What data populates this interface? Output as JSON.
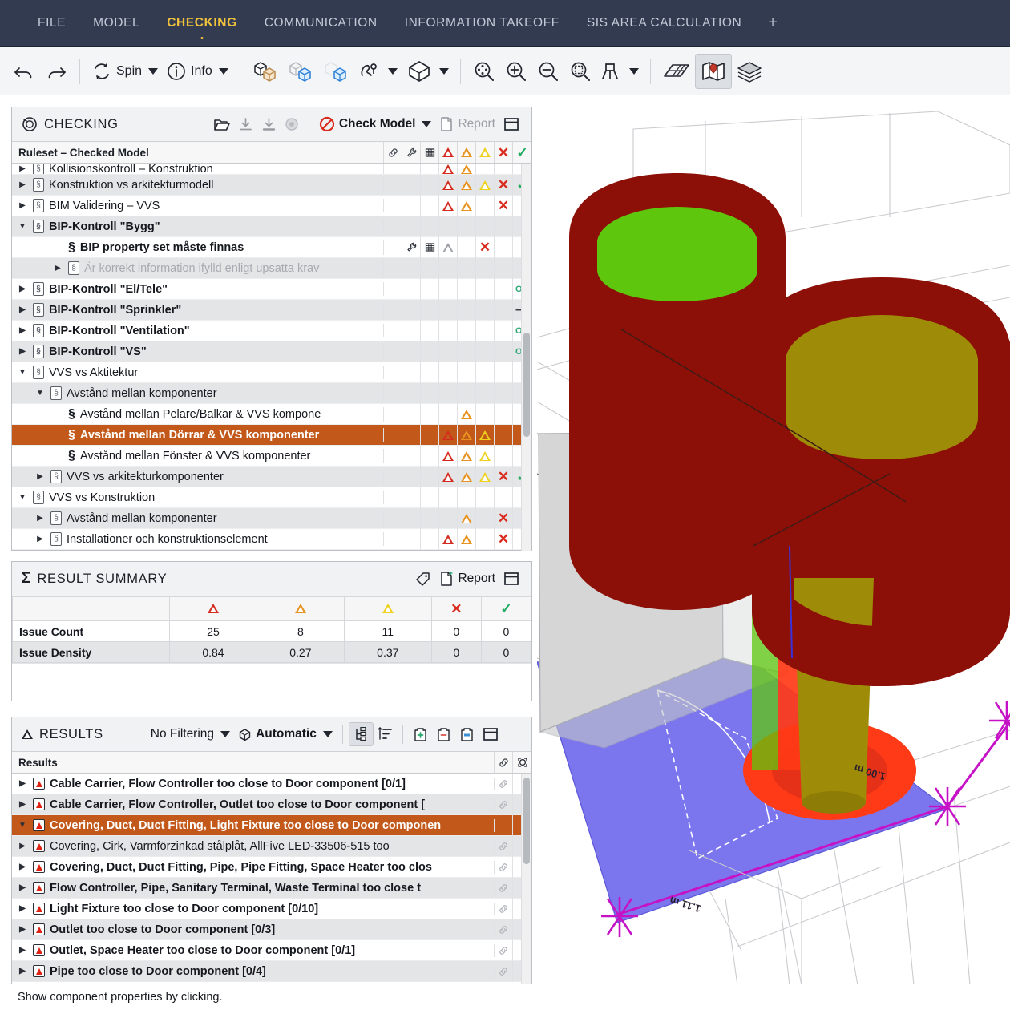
{
  "menubar": {
    "items": [
      {
        "label": "FILE",
        "active": false
      },
      {
        "label": "MODEL",
        "active": false
      },
      {
        "label": "CHECKING",
        "active": true
      },
      {
        "label": "COMMUNICATION",
        "active": false
      },
      {
        "label": "INFORMATION TAKEOFF",
        "active": false
      },
      {
        "label": "SIS AREA CALCULATION",
        "active": false
      }
    ],
    "add_label": "+"
  },
  "toolbar": {
    "undo": "undo-icon",
    "redo": "redo-icon",
    "spin_label": "Spin",
    "info_label": "Info",
    "icons": [
      "select-objects-icon",
      "select-transparent-icon",
      "select-hidden-icon",
      "paint-select-icon",
      "cube-view-icon",
      "zoom-fit-icon",
      "zoom-in-icon",
      "zoom-out-icon",
      "zoom-area-icon",
      "clip-plane-icon",
      "grid-icon",
      "map-pin-icon",
      "layers-icon"
    ]
  },
  "checking_panel": {
    "title": "CHECKING",
    "title_icon": "check-badge-icon",
    "open_icon": "open-folder-icon",
    "import_icon": "import-icon",
    "export_icon": "export-icon",
    "record_icon": "record-icon",
    "check_model_label": "Check Model",
    "check_model_icon": "forbidden-icon",
    "report_label": "Report",
    "report_icon": "report-doc-icon",
    "collapse_icon": "collapse-panel-icon",
    "grid_header": {
      "name": "Ruleset – Checked Model",
      "columns": [
        "link-icon",
        "wrench-icon",
        "table-icon",
        "red-triangle",
        "orange-triangle",
        "yellow-triangle",
        "x-mark",
        "check-mark"
      ]
    },
    "rows": [
      {
        "label": "Kollisionskontroll – Konstruktion",
        "indent": 1,
        "twist": "closed",
        "icon": "ruleset",
        "alt": false,
        "clipped": true,
        "marks": [
          "",
          "",
          "",
          "red",
          "orange",
          "",
          "",
          ""
        ]
      },
      {
        "label": "Konstruktion vs arkitekturmodell",
        "indent": 1,
        "twist": "closed",
        "icon": "ruleset",
        "alt": true,
        "marks": [
          "",
          "",
          "",
          "red",
          "orange",
          "yellow",
          "x",
          "check"
        ]
      },
      {
        "label": "BIM Validering – VVS",
        "indent": 1,
        "twist": "closed",
        "icon": "ruleset",
        "alt": false,
        "marks": [
          "",
          "",
          "",
          "red",
          "orange",
          "",
          "x",
          ""
        ]
      },
      {
        "label": "BIP-Kontroll \"Bygg\"",
        "indent": 1,
        "twist": "open",
        "icon": "ruleset",
        "alt": true,
        "bold": true,
        "marks": [
          "",
          "",
          "",
          "",
          "",
          "",
          "",
          ""
        ]
      },
      {
        "label": "BIP property set måste finnas",
        "indent": 3,
        "twist": "none",
        "icon": "para",
        "alt": false,
        "bold": true,
        "marks": [
          "",
          "wrench",
          "table",
          "hollow",
          "",
          "x",
          "",
          ""
        ]
      },
      {
        "label": "Är korrekt information ifylld enligt upsatta krav",
        "indent": 3,
        "twist": "closed",
        "icon": "ruleset",
        "alt": true,
        "disabled": true,
        "marks": [
          "",
          "",
          "",
          "",
          "",
          "",
          "",
          ""
        ]
      },
      {
        "label": "BIP-Kontroll \"El/Tele\"",
        "indent": 1,
        "twist": "closed",
        "icon": "ruleset",
        "alt": false,
        "bold": true,
        "marks": [
          "",
          "",
          "",
          "",
          "",
          "",
          "",
          "ok"
        ]
      },
      {
        "label": "BIP-Kontroll \"Sprinkler\"",
        "indent": 1,
        "twist": "closed",
        "icon": "ruleset",
        "alt": true,
        "bold": true,
        "marks": [
          "",
          "",
          "",
          "",
          "",
          "",
          "",
          "dash"
        ]
      },
      {
        "label": "BIP-Kontroll \"Ventilation\"",
        "indent": 1,
        "twist": "closed",
        "icon": "ruleset",
        "alt": false,
        "bold": true,
        "marks": [
          "",
          "",
          "",
          "",
          "",
          "",
          "",
          "ok"
        ]
      },
      {
        "label": "BIP-Kontroll \"VS\"",
        "indent": 1,
        "twist": "closed",
        "icon": "ruleset",
        "alt": true,
        "bold": true,
        "marks": [
          "",
          "",
          "",
          "",
          "",
          "",
          "",
          "ok"
        ]
      },
      {
        "label": "VVS vs Aktitektur",
        "indent": 1,
        "twist": "open",
        "icon": "ruleset",
        "alt": false,
        "marks": [
          "",
          "",
          "",
          "",
          "",
          "",
          "",
          ""
        ]
      },
      {
        "label": "Avstånd mellan komponenter",
        "indent": 2,
        "twist": "open",
        "icon": "ruleset",
        "alt": true,
        "marks": [
          "",
          "",
          "",
          "",
          "",
          "",
          "",
          ""
        ]
      },
      {
        "label": "Avstånd mellan Pelare/Balkar & VVS kompone",
        "indent": 3,
        "twist": "none",
        "icon": "para",
        "alt": false,
        "marks": [
          "",
          "",
          "",
          "",
          "orange",
          "",
          "",
          ""
        ]
      },
      {
        "label": "Avstånd mellan Dörrar & VVS komponenter",
        "indent": 3,
        "twist": "none",
        "icon": "para",
        "alt": false,
        "selected": true,
        "marks": [
          "",
          "",
          "",
          "red",
          "orange",
          "yellow",
          "",
          ""
        ]
      },
      {
        "label": "Avstånd mellan Fönster & VVS komponenter",
        "indent": 3,
        "twist": "none",
        "icon": "para",
        "alt": false,
        "marks": [
          "",
          "",
          "",
          "red",
          "orange",
          "yellow",
          "",
          ""
        ]
      },
      {
        "label": "VVS vs arkitekturkomponenter",
        "indent": 2,
        "twist": "closed",
        "icon": "ruleset",
        "alt": true,
        "marks": [
          "",
          "",
          "",
          "red",
          "orange",
          "yellow",
          "x",
          "check"
        ]
      },
      {
        "label": "VVS vs Konstruktion",
        "indent": 1,
        "twist": "open",
        "icon": "ruleset",
        "alt": false,
        "marks": [
          "",
          "",
          "",
          "",
          "",
          "",
          "",
          ""
        ]
      },
      {
        "label": "Avstånd mellan komponenter",
        "indent": 2,
        "twist": "closed",
        "icon": "ruleset",
        "alt": true,
        "marks": [
          "",
          "",
          "",
          "",
          "orange",
          "",
          "x",
          ""
        ]
      },
      {
        "label": "Installationer och konstruktionselement",
        "indent": 2,
        "twist": "closed",
        "icon": "ruleset",
        "alt": false,
        "marks": [
          "",
          "",
          "",
          "red",
          "orange",
          "",
          "x",
          ""
        ]
      }
    ]
  },
  "result_summary": {
    "title": "RESULT SUMMARY",
    "title_icon": "sigma-icon",
    "tag_icon": "tag-icon",
    "report_label": "Report",
    "report_icon": "report-doc-icon",
    "collapse_icon": "collapse-panel-icon",
    "columns": [
      "red-triangle",
      "orange-triangle",
      "yellow-triangle",
      "x-mark",
      "check-mark"
    ],
    "rows": [
      {
        "label": "Issue Count",
        "values": [
          "25",
          "8",
          "11",
          "0",
          "0"
        ]
      },
      {
        "label": "Issue Density",
        "values": [
          "0.84",
          "0.27",
          "0.37",
          "0",
          "0"
        ]
      }
    ]
  },
  "results_panel": {
    "title": "RESULTS",
    "title_icon": "triangle-outline-icon",
    "filter_label": "No Filtering",
    "grouping_label": "Automatic",
    "grouping_icon": "cube-small-icon",
    "tree_view_icon": "tree-structure-icon",
    "list_view_icon": "sorted-list-icon",
    "add_icon": "add-result-icon",
    "remove_icon": "remove-result-icon",
    "edit_icon": "edit-result-icon",
    "collapse_icon": "collapse-panel-icon",
    "grid_header": {
      "name": "Results",
      "columns": [
        "link-icon",
        "highlight-icon"
      ]
    },
    "rows": [
      {
        "label": "Cable Carrier, Flow Controller too close to Door component [0/1]",
        "indent": 1,
        "twist": "closed",
        "alt": false,
        "link": true
      },
      {
        "label": "Cable Carrier, Flow Controller, Outlet too close to Door component [",
        "indent": 1,
        "twist": "closed",
        "alt": true,
        "link": true
      },
      {
        "label": "Covering, Duct, Duct Fitting, Light Fixture too close to Door componen",
        "indent": 1,
        "twist": "open",
        "alt": false,
        "selected": true,
        "link": false
      },
      {
        "label": "Covering, Cirk, Varmförzinkad stålplåt, AllFive LED-33506-515 too ",
        "indent": 2,
        "twist": "closed",
        "alt": true,
        "sub": true,
        "link": true
      },
      {
        "label": "Covering, Duct, Duct Fitting, Pipe, Pipe Fitting, Space Heater too clos",
        "indent": 1,
        "twist": "closed",
        "alt": false,
        "link": true
      },
      {
        "label": "Flow Controller, Pipe, Sanitary Terminal, Waste Terminal too close t",
        "indent": 1,
        "twist": "closed",
        "alt": true,
        "link": true
      },
      {
        "label": "Light Fixture too close to Door component [0/10]",
        "indent": 1,
        "twist": "closed",
        "alt": false,
        "link": true
      },
      {
        "label": "Outlet too close to Door component [0/3]",
        "indent": 1,
        "twist": "closed",
        "alt": true,
        "link": true
      },
      {
        "label": "Outlet, Space Heater too close to Door component [0/1]",
        "indent": 1,
        "twist": "closed",
        "alt": false,
        "link": true
      },
      {
        "label": "Pipe too close to Door component [0/4]",
        "indent": 1,
        "twist": "closed",
        "alt": true,
        "link": true
      }
    ]
  },
  "statusbar": {
    "message": "Show component properties by clicking."
  },
  "viewport": {
    "dimension_labels": [
      {
        "text": "1.11 m"
      },
      {
        "text": "1.00 m"
      }
    ],
    "colors": {
      "clash_body": "#8c1008",
      "green_top": "#5ec70d",
      "olive_top": "#9e8b07",
      "slab": "#7b76ee",
      "wall": "#d6d6d6",
      "highlight_red": "#ff3a16",
      "dimension_magenta": "#c612c6"
    }
  },
  "theme": {
    "menubar_bg": "#333b51",
    "accent_yellow": "#f0c23c",
    "selection_orange": "#c2581a",
    "toolbar_bg": "#f4f5f7"
  }
}
